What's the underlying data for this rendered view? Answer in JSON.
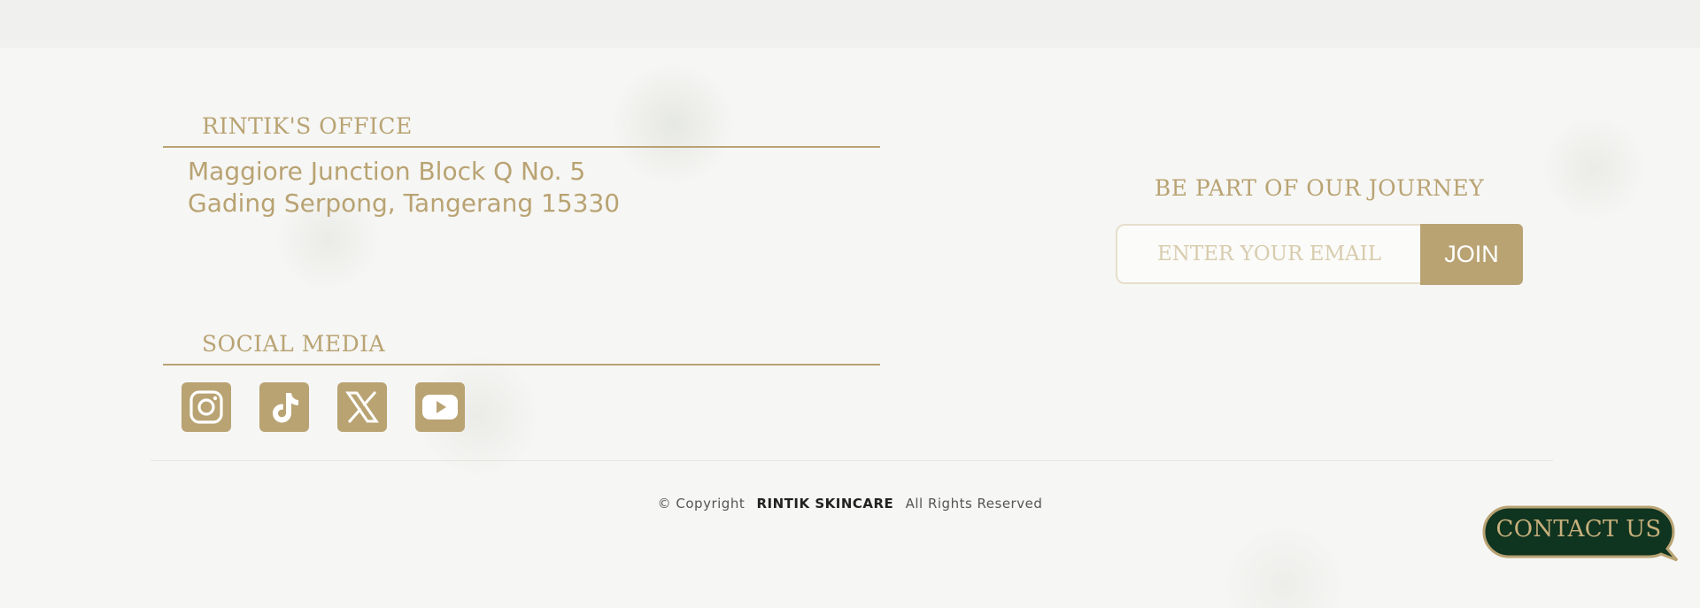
{
  "office": {
    "title": "RINTIK'S OFFICE",
    "address_line1": "Maggiore Junction Block Q No. 5",
    "address_line2": "Gading Serpong, Tangerang 15330"
  },
  "social": {
    "title": "SOCIAL MEDIA",
    "items": [
      {
        "icon": "instagram-icon"
      },
      {
        "icon": "tiktok-icon"
      },
      {
        "icon": "x-icon"
      },
      {
        "icon": "youtube-icon"
      }
    ]
  },
  "newsletter": {
    "title": "BE PART OF OUR JOURNEY",
    "email_placeholder": "ENTER YOUR EMAIL",
    "join_label": "JOIN"
  },
  "footer": {
    "copyright_prefix": "© Copyright",
    "brand": "RINTIK SKINCARE",
    "rights": "All Rights Reserved"
  },
  "contact": {
    "label": "CONTACT US"
  },
  "colors": {
    "gold": "#b9a373",
    "dark_green": "#0f3420",
    "background": "#f6f6f4"
  }
}
